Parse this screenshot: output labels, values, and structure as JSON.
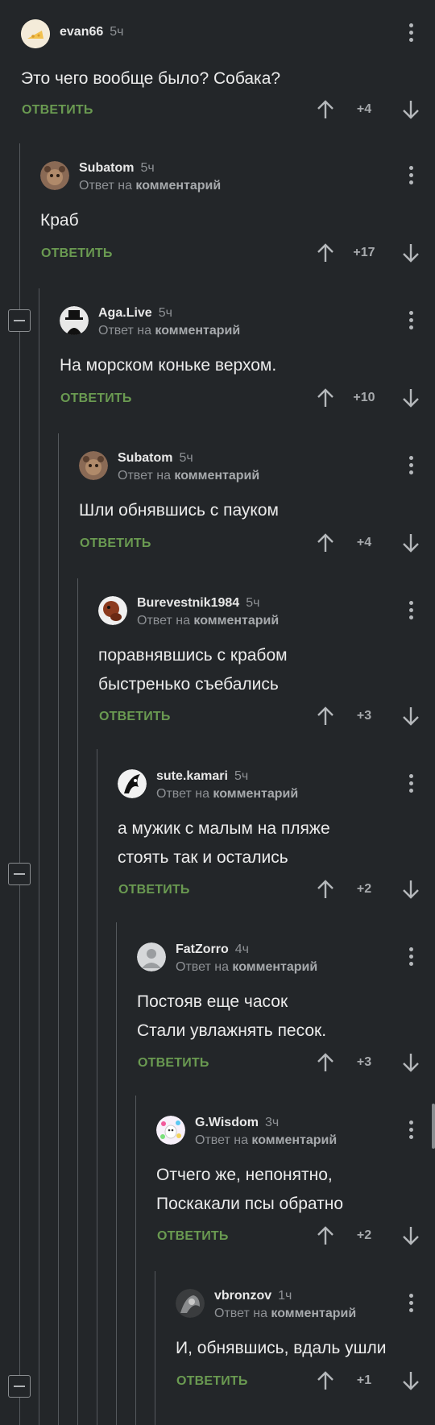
{
  "reply_to_prefix": "Ответ на",
  "reply_to_target": "комментарий",
  "reply_label": "ОТВЕТИТЬ",
  "comments": [
    {
      "user": "evan66",
      "time": "5ч",
      "avatar": "avatar-evan66",
      "lines": [
        "Это чего вообще было? Собака?"
      ],
      "score": "+4",
      "is_reply": false
    },
    {
      "user": "Subatom",
      "time": "5ч",
      "avatar": "avatar-subatom",
      "lines": [
        "Краб"
      ],
      "score": "+17",
      "is_reply": true
    },
    {
      "user": "Aga.Live",
      "time": "5ч",
      "avatar": "avatar-agalive",
      "lines": [
        "На морском коньке верхом."
      ],
      "score": "+10",
      "is_reply": true
    },
    {
      "user": "Subatom",
      "time": "5ч",
      "avatar": "avatar-subatom",
      "lines": [
        "Шли обнявшись с пауком"
      ],
      "score": "+4",
      "is_reply": true
    },
    {
      "user": "Burevestnik1984",
      "time": "5ч",
      "avatar": "avatar-burevestnik",
      "lines": [
        "поравнявшись с крабом",
        "быстренько съебались"
      ],
      "score": "+3",
      "is_reply": true
    },
    {
      "user": "sute.kamari",
      "time": "5ч",
      "avatar": "avatar-sutekamari",
      "lines": [
        "а мужик с малым на пляже",
        "стоять так и остались"
      ],
      "score": "+2",
      "is_reply": true
    },
    {
      "user": "FatZorro",
      "time": "4ч",
      "avatar": "avatar-fatzorro",
      "lines": [
        "Постояв еще часок",
        "Стали увлажнять песок."
      ],
      "score": "+3",
      "is_reply": true
    },
    {
      "user": "G.Wisdom",
      "time": "3ч",
      "avatar": "avatar-gwisdom",
      "lines": [
        "Отчего же, непонятно,",
        "Поскакали псы обратно"
      ],
      "score": "+2",
      "is_reply": true
    },
    {
      "user": "vbronzov",
      "time": "1ч",
      "avatar": "avatar-vbronzov",
      "lines": [
        "И, обнявшись, вдаль ушли"
      ],
      "score": "+1",
      "is_reply": true
    }
  ]
}
